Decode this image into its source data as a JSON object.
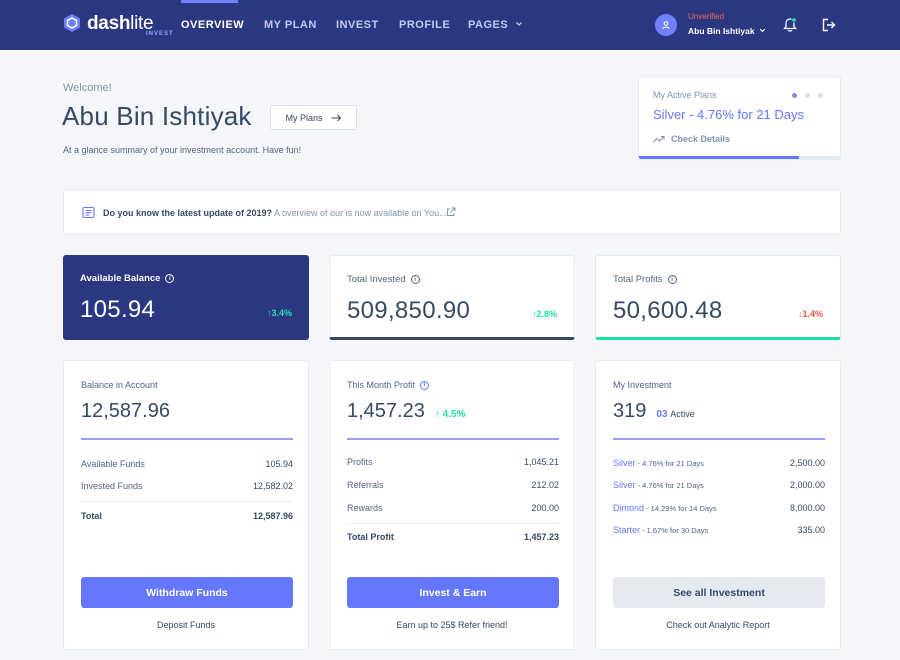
{
  "header": {
    "logo_word": "dash",
    "logo_word_light": "lite",
    "logo_sub": "INVEST",
    "nav": [
      {
        "label": "OVERVIEW"
      },
      {
        "label": "MY PLAN"
      },
      {
        "label": "INVEST"
      },
      {
        "label": "PROFILE"
      },
      {
        "label": "PAGES"
      }
    ],
    "user": {
      "status": "Unverified",
      "name": "Abu Bin Ishtiyak"
    },
    "accent_color": "#2c3782"
  },
  "hero": {
    "welcome": "Welcome!",
    "name": "Abu Bin Ishtiyak",
    "my_plans_label": "My Plans",
    "subtitle": "At a glance summary of your investment account. Have fun!"
  },
  "active_plans": {
    "label": "My Active Plans",
    "value": "Silver - 4.76% for 21 Days",
    "link": "Check Details",
    "progress_fraction": 0.79
  },
  "notice": {
    "bold": "Do you know the latest update of 2019?",
    "link": " A overview of our is now available on You..."
  },
  "stats": [
    {
      "label": "Available Balance",
      "value": "105.94",
      "change": "3.4%",
      "direction": "up"
    },
    {
      "label": "Total Invested",
      "value": "509,850.90",
      "change": "2.8%",
      "direction": "up"
    },
    {
      "label": "Total Profits",
      "value": "50,600.48",
      "change": "1.4%",
      "direction": "down"
    }
  ],
  "balance_card": {
    "label": "Balance in Account",
    "value": "12,587.96",
    "rows": [
      {
        "label": "Available Funds",
        "amount": "105.94"
      },
      {
        "label": "Invested Funds",
        "amount": "12,582.02"
      }
    ],
    "total": {
      "label": "Total",
      "amount": "12,587.96"
    },
    "button": "Withdraw Funds",
    "footer": "Deposit Funds"
  },
  "profit_card": {
    "label": "This Month Profit",
    "value": "1,457.23",
    "change": "4.5%",
    "rows": [
      {
        "label": "Profits",
        "amount": "1,045.21"
      },
      {
        "label": "Referrals",
        "amount": "212.02"
      },
      {
        "label": "Rewards",
        "amount": "200.00"
      }
    ],
    "total": {
      "label": "Total Profit",
      "amount": "1,457.23"
    },
    "button": "Invest & Earn",
    "footer_prefix": "Earn up to 25$ ",
    "footer_link": "Refer friend!"
  },
  "investment_card": {
    "label": "My Investment",
    "value": "319",
    "active_count": "03",
    "active_label": "Active",
    "rows": [
      {
        "name": "Silver",
        "detail": " - 4.76% for 21 Days",
        "amount": "2,500.00"
      },
      {
        "name": "Silver",
        "detail": " - 4.76% for 21 Days",
        "amount": "2,000.00"
      },
      {
        "name": "Dimond",
        "detail": " - 14.29% for 14 Days",
        "amount": "8,000.00"
      },
      {
        "name": "Starter",
        "detail": " - 1.67% for 30 Days",
        "amount": "335.00"
      }
    ],
    "button": "See all Investment",
    "footer_prefix": "Check out ",
    "footer_link": "Analytic Report"
  }
}
